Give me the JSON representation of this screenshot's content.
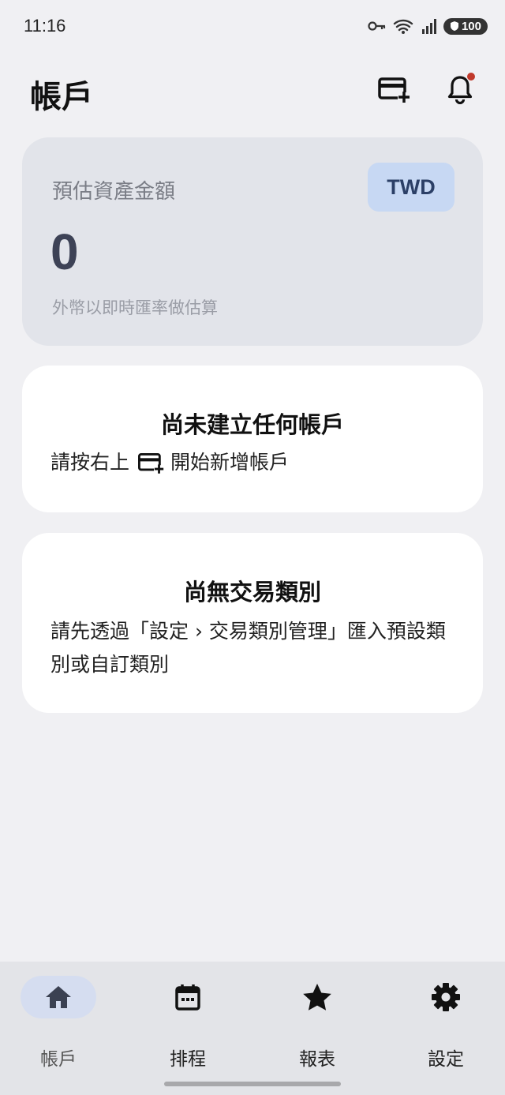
{
  "status_bar": {
    "time": "11:16",
    "battery": "100"
  },
  "header": {
    "title": "帳戶",
    "add_account_icon": "card-plus-icon",
    "notification_icon": "bell-icon"
  },
  "asset_card": {
    "label": "預估資產金額",
    "currency": "TWD",
    "value": "0",
    "note": "外幣以即時匯率做估算"
  },
  "empty_accounts": {
    "title": "尚未建立任何帳戶",
    "body_prefix": "請按右上",
    "body_suffix": "開始新增帳戶"
  },
  "empty_categories": {
    "title": "尚無交易類別",
    "body": "請先透過「設定 › 交易類別管理」匯入預設類別或自訂類別"
  },
  "bottom_nav": {
    "items": [
      {
        "label": "帳戶",
        "icon": "home-icon",
        "active": true
      },
      {
        "label": "排程",
        "icon": "calendar-icon",
        "active": false
      },
      {
        "label": "報表",
        "icon": "star-icon",
        "active": false
      },
      {
        "label": "設定",
        "icon": "gear-icon",
        "active": false
      }
    ]
  },
  "colors": {
    "background": "#f0f0f3",
    "asset_card": "#e2e4ea",
    "currency_chip": "#c7d8f3",
    "nav_active": "#d5ddf0",
    "notification_dot": "#c0392b"
  }
}
